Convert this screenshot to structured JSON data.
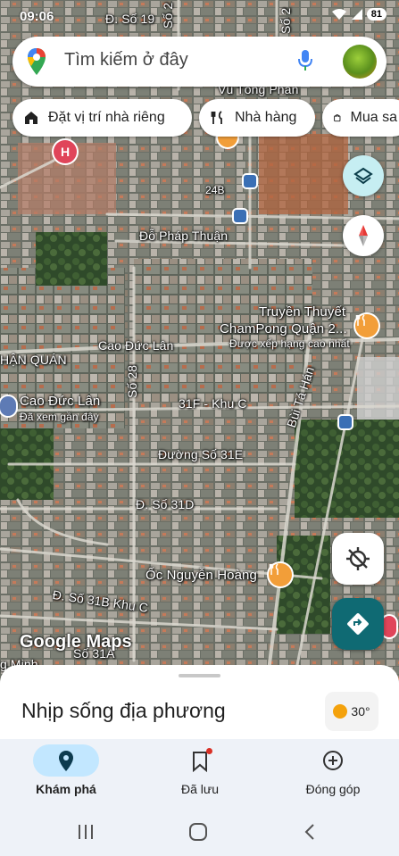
{
  "status": {
    "time": "09:06",
    "battery": "81"
  },
  "search": {
    "placeholder": "Tìm kiếm ở đây"
  },
  "chips": [
    {
      "label": "Đặt vị trí nhà riêng",
      "icon": "home-icon"
    },
    {
      "label": "Nhà hàng",
      "icon": "restaurant-icon"
    },
    {
      "label": "Mua sa",
      "icon": "shopping-bag-icon"
    }
  ],
  "map_labels": {
    "street_so_19": "Đ. Số 19",
    "street_so_2a": "Số 2",
    "street_so_2b": "Số 2",
    "vu_tong_phan": "Vũ Tông Phan",
    "street_24b": "24B",
    "do_phap_thuan": "Đỗ Pháp Thuận",
    "truyen_thuyet": "Truyền Thuyết",
    "champong": "ChamPong Quận 2...",
    "top_rated": "Được xếp hạng cao nhất",
    "cao_duc_lan_street": "Cao Đức Lân",
    "han_quan": "HẬN QUÁN",
    "so_28": "Số 28",
    "bui_ta_han": "Bùi Tá Hán",
    "cao_duc_lan_place": "Cao Đức Lân",
    "viewed_recently": "Đã xem gần đây",
    "street_31f": "31F - Khu C",
    "street_31e": "Đường Số 31E",
    "street_31d": "Đ. Số 31D",
    "oc_nguyen_hoang": "Ốc Nguyễn Hoàng",
    "street_31b": "Đ. Số 31B Khu C",
    "street_31a": "Số 31A",
    "minh": "g Minh"
  },
  "map_brand": "Google Maps",
  "sheet": {
    "title": "Nhịp sống địa phương",
    "temperature": "30°"
  },
  "nav": [
    {
      "label": "Khám phá",
      "icon": "explore-pin-icon",
      "active": true
    },
    {
      "label": "Đã lưu",
      "icon": "bookmark-icon",
      "active": false
    },
    {
      "label": "Đóng góp",
      "icon": "add-circle-icon",
      "active": false
    }
  ],
  "colors": {
    "accent": "#0b57d0",
    "active_pill": "#c2e7ff",
    "directions": "#0f6a73",
    "poi_food": "#f29e39",
    "poi_hospital": "#e0455a"
  }
}
